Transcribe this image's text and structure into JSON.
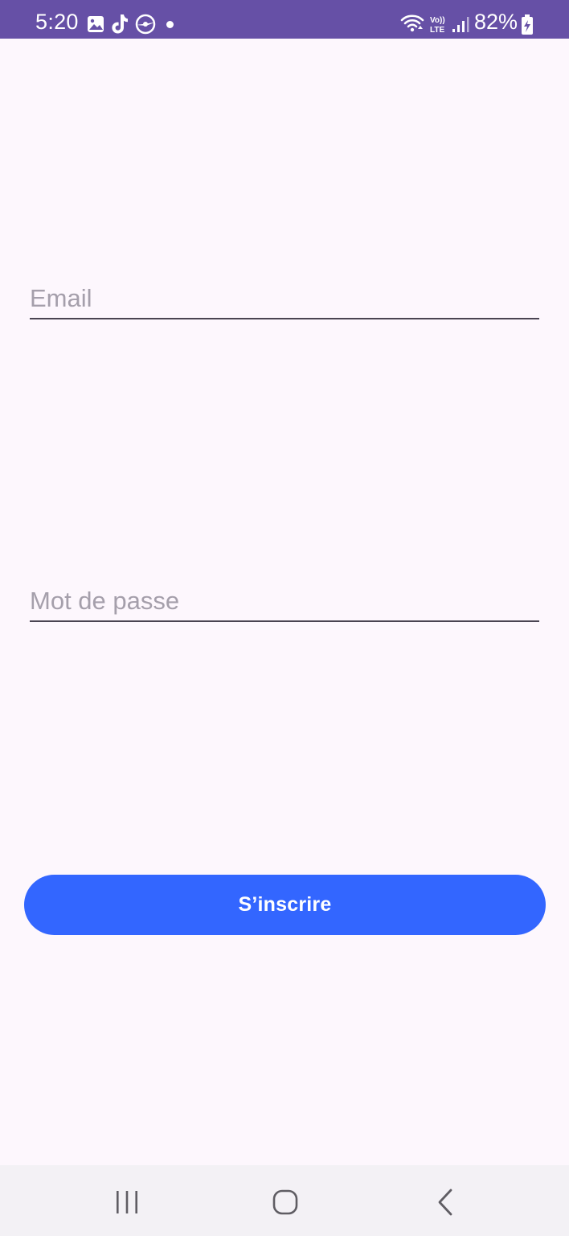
{
  "status_bar": {
    "time": "5:20",
    "battery": "82%",
    "background_color": "#6650a6",
    "icons_left": [
      "gallery-icon",
      "tiktok-icon",
      "vpn-icon",
      "notification-dot-icon"
    ],
    "icons_right": [
      "wifi-icon",
      "volte-icon",
      "signal-icon",
      "battery-charging-icon"
    ]
  },
  "form": {
    "email_placeholder": "Email",
    "email_value": "",
    "password_placeholder": "Mot de passe",
    "password_value": "",
    "submit_label": "S’inscrire",
    "submit_color": "#3366ff"
  },
  "nav_bar": {
    "buttons": [
      "recent-apps-icon",
      "home-icon",
      "back-icon"
    ]
  }
}
